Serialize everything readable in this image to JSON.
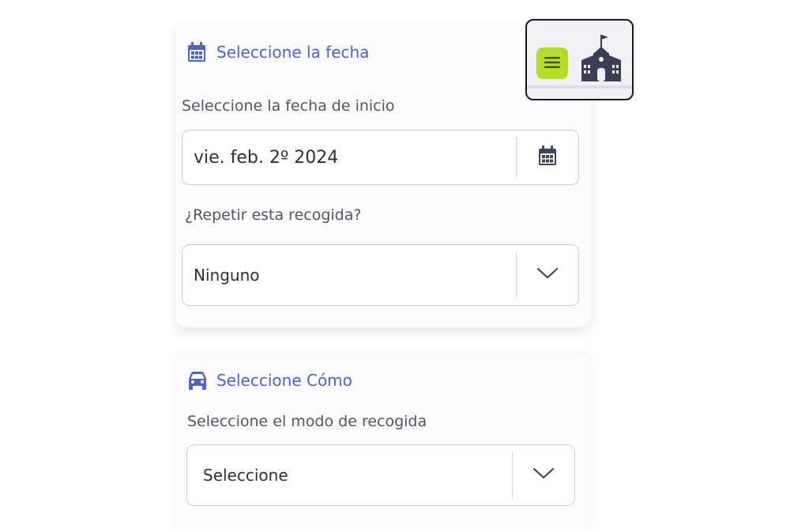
{
  "date_section": {
    "title": "Seleccione la fecha",
    "start_label": "Seleccione la fecha de inicio",
    "start_value": "vie. feb. 2º 2024",
    "repeat_label": "¿Repetir esta recogida?",
    "repeat_value": "Ninguno"
  },
  "how_section": {
    "title": "Seleccione Cómo",
    "mode_label": "Seleccione el modo de recogida",
    "mode_value": "Seleccione"
  },
  "header": {
    "menu_icon": "hamburger-menu-icon",
    "logo_icon": "school-building-icon",
    "accent_color": "#b4dd2a"
  },
  "colors": {
    "title_blue": "#4d63c4",
    "border": "#c9cbe6",
    "icon_dark": "#3f4459"
  }
}
